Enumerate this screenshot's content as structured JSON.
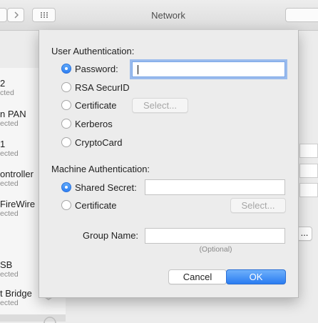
{
  "window": {
    "title": "Network"
  },
  "sidebar": {
    "items": [
      {
        "name": "2",
        "status": "cted"
      },
      {
        "name": "n PAN",
        "status": "ected"
      },
      {
        "name": "1",
        "status": "ected"
      },
      {
        "name": "ontroller",
        "status": "ected"
      },
      {
        "name": " FireWire",
        "status": "ected"
      },
      {
        "name": "SB",
        "status": "ected"
      },
      {
        "name": "t Bridge",
        "status": "ected"
      }
    ]
  },
  "sheet": {
    "user_auth": {
      "label": "User Authentication:",
      "options": [
        {
          "label": "Password:",
          "selected": true
        },
        {
          "label": "RSA SecurID",
          "selected": false
        },
        {
          "label": "Certificate",
          "selected": false
        },
        {
          "label": "Kerberos",
          "selected": false
        },
        {
          "label": "CryptoCard",
          "selected": false
        }
      ],
      "password_value": "",
      "select_label": "Select..."
    },
    "machine_auth": {
      "label": "Machine Authentication:",
      "options": [
        {
          "label": "Shared Secret:",
          "selected": true
        },
        {
          "label": "Certificate",
          "selected": false
        }
      ],
      "shared_secret_value": "",
      "select_label": "Select..."
    },
    "group": {
      "label": "Group Name:",
      "value": "",
      "hint": "(Optional)"
    },
    "buttons": {
      "cancel": "Cancel",
      "ok": "OK"
    }
  },
  "background": {
    "ellipsis_label": "..."
  },
  "colors": {
    "accent": "#2f7ff3",
    "focus_ring": "#5894ee"
  }
}
